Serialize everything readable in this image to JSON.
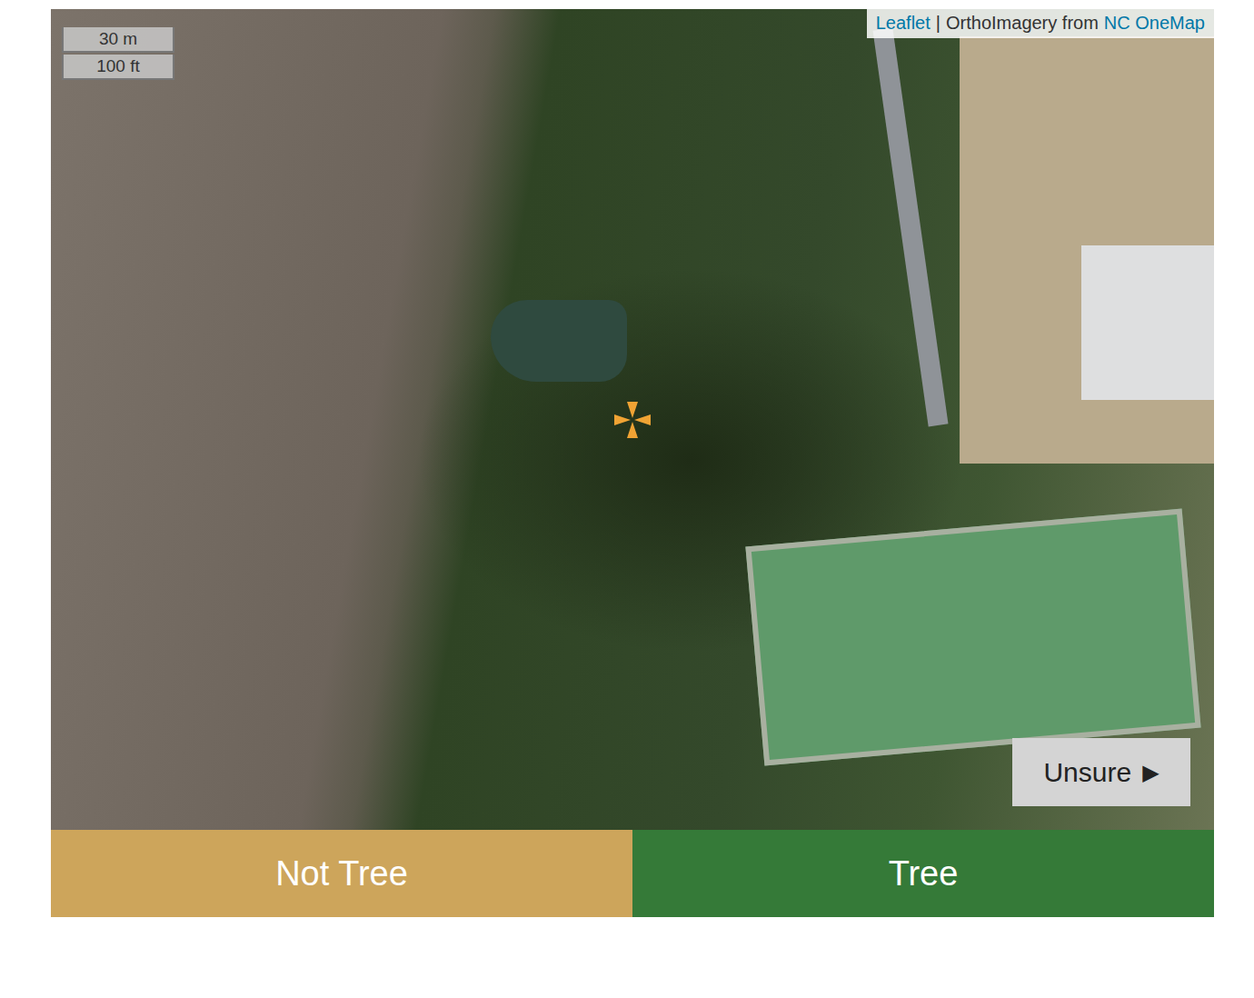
{
  "map": {
    "scale": [
      "30 m",
      "100 ft"
    ],
    "attribution": {
      "link": "Leaflet",
      "separator": "|",
      "source_prefix": "OrthoImagery from",
      "source_link": "NC OneMap"
    },
    "unsure_button": {
      "label": "Unsure",
      "icon": "▶"
    }
  },
  "answer_buttons": [
    {
      "label": "Not Tree",
      "color": "#cda55b"
    },
    {
      "label": "Tree",
      "color": "#357a38"
    }
  ]
}
